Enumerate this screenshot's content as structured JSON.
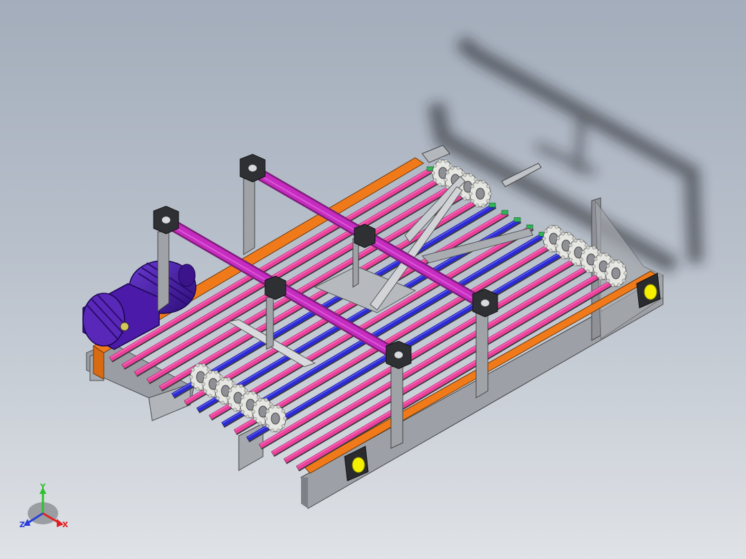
{
  "viewport": {
    "background_top": "#a3adbb",
    "background_bottom": "#dfe2e6"
  },
  "model": {
    "parts": [
      "drive-motor",
      "conveyor-frame",
      "roller-straps",
      "sprocket-wheels",
      "gantry-bars",
      "end-caps",
      "shadow"
    ],
    "colors": {
      "pink_strap": "#ec3f9c",
      "blue_strap": "#2c2ad6",
      "magenta_bar": "#c62cc0",
      "orange_rail": "#f07a1a",
      "motor": "#4b1aa8",
      "frame": "#8f939a",
      "sprocket": "#e6e6e2",
      "clip": "#2fb558",
      "end_cap": "#f5f000"
    }
  },
  "triad": {
    "y_label": "Y",
    "z_label": "Z",
    "x_label": "X",
    "y_color": "#2ec12e",
    "z_color": "#2a3fd9",
    "x_color": "#e02020"
  }
}
